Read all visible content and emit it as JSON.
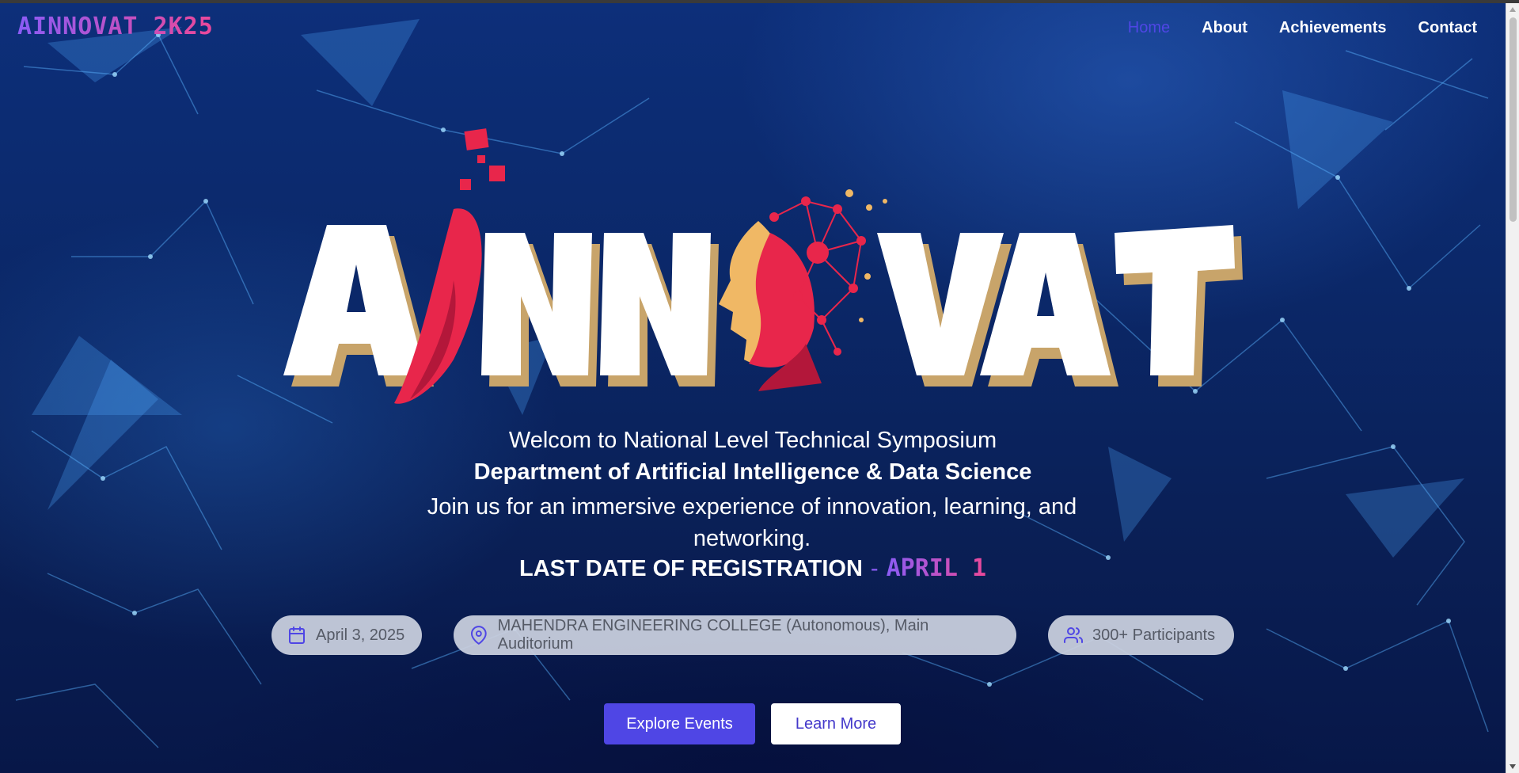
{
  "brand": {
    "title": "AINNOVAT 2K25"
  },
  "nav": {
    "items": [
      {
        "label": "Home",
        "active": true
      },
      {
        "label": "About"
      },
      {
        "label": "Achievements"
      },
      {
        "label": "Contact"
      }
    ]
  },
  "hero": {
    "logo_text": "AINNOVAT",
    "welcome": "Welcom to National Level Technical Symposium",
    "department": "Department of Artificial Intelligence & Data Science",
    "tagline": "Join us for an immersive experience of innovation, learning, and networking.",
    "registration_label": "LAST DATE OF REGISTRATION",
    "registration_separator": "-",
    "registration_date": "APRIL 1"
  },
  "info_pills": [
    {
      "icon": "calendar-icon",
      "text": "April 3, 2025"
    },
    {
      "icon": "map-pin-icon",
      "text": "MAHENDRA ENGINEERING COLLEGE (Autonomous), Main Auditorium"
    },
    {
      "icon": "users-icon",
      "text": "300+ Participants"
    }
  ],
  "actions": {
    "primary_label": "Explore Events",
    "secondary_label": "Learn More"
  },
  "colors": {
    "accent": "#4f46e5",
    "gradient_start": "#8b5cf6",
    "gradient_end": "#ec4899",
    "logo_red": "#e8264b",
    "logo_gold": "#c8a46a"
  }
}
